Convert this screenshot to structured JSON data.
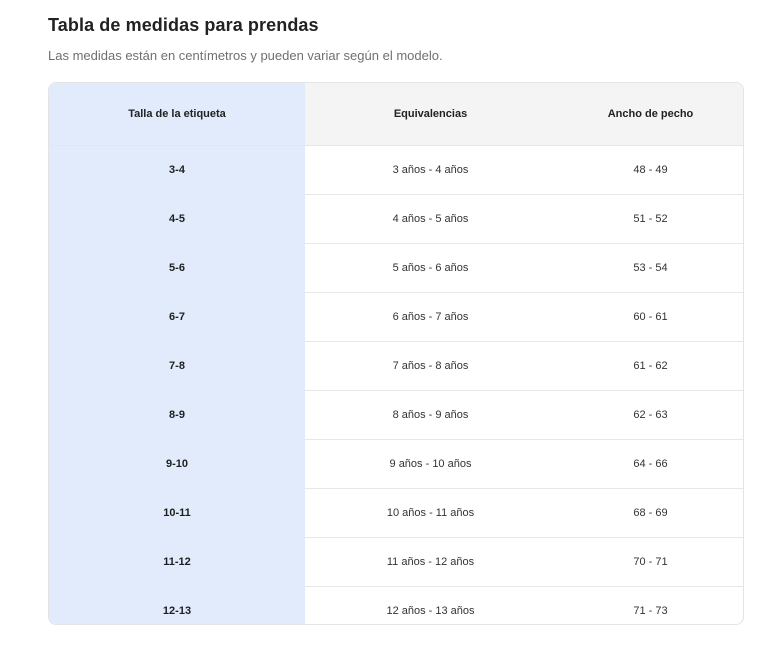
{
  "title": "Tabla de medidas para prendas",
  "subtitle": "Las medidas están en centímetros y pueden variar según el modelo.",
  "table": {
    "headers": [
      "Talla de la etiqueta",
      "Equivalencias",
      "Ancho de pecho"
    ],
    "rows": [
      [
        "3-4",
        "3 años - 4 años",
        "48 - 49"
      ],
      [
        "4-5",
        "4 años - 5 años",
        "51 - 52"
      ],
      [
        "5-6",
        "5 años - 6 años",
        "53 - 54"
      ],
      [
        "6-7",
        "6 años - 7 años",
        "60 - 61"
      ],
      [
        "7-8",
        "7 años - 8 años",
        "61 - 62"
      ],
      [
        "8-9",
        "8 años - 9 años",
        "62 - 63"
      ],
      [
        "9-10",
        "9 años - 10 años",
        "64 - 66"
      ],
      [
        "10-11",
        "10 años - 11 años",
        "68 - 69"
      ],
      [
        "11-12",
        "11 años - 12 años",
        "70 - 71"
      ],
      [
        "12-13",
        "12 años - 13 años",
        "71 - 73"
      ]
    ]
  },
  "colors": {
    "highlight_column": "#e1ebfc",
    "header_background": "#f4f4f4"
  }
}
